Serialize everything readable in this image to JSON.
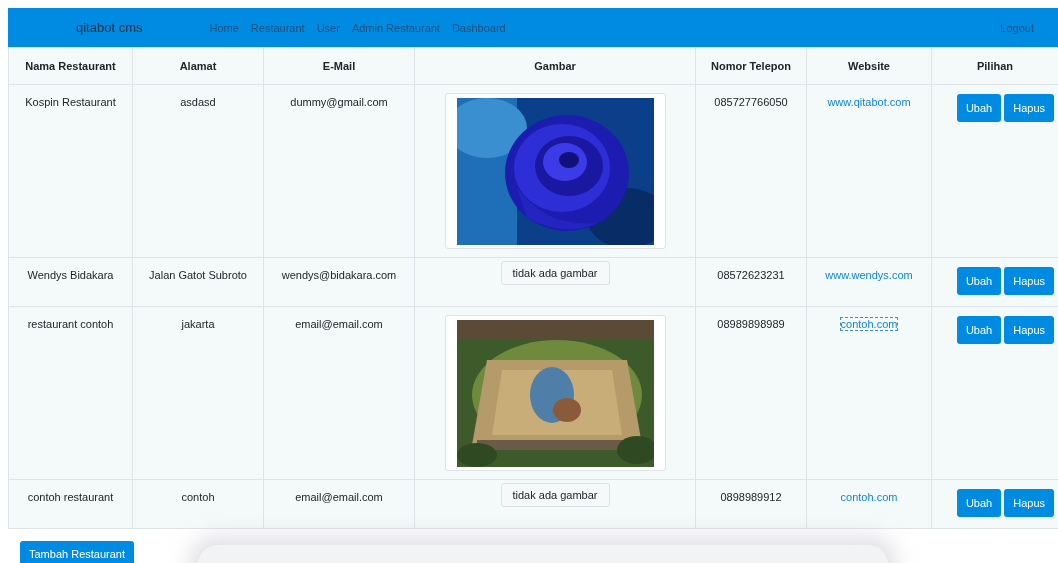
{
  "navbar": {
    "brand": "qitabot cms",
    "links": [
      "Home",
      "Restaurant",
      "User",
      "Admin Restaurant",
      "Dashboard"
    ],
    "logout": "Logout"
  },
  "table": {
    "columns": [
      "Nama Restaurant",
      "Alamat",
      "E-Mail",
      "Gambar",
      "Nomor Telepon",
      "Website",
      "Pilihan"
    ],
    "rows": [
      {
        "name": "Kospin Restaurant",
        "address": "asdasd",
        "email": "dummy@gmail.com",
        "phone": "085727766050",
        "website": "www.qitabot.com",
        "website_focused": false,
        "actions": [
          "Ubah",
          "Hapus"
        ]
      },
      {
        "name": "Wendys Bidakara",
        "address": "Jalan Gatot Subroto",
        "email": "wendys@bidakara.com",
        "image": {
          "kind": "none",
          "label": "tidak ada gambar"
        },
        "phone": "08572623231",
        "website": "www.wendys.com",
        "website_focused": false,
        "actions": [
          "Ubah",
          "Hapus"
        ]
      },
      {
        "name": "restaurant contoh",
        "address": "jakarta",
        "email": "email@email.com",
        "phone": "08989898989",
        "website": "contoh.com",
        "website_focused": true,
        "actions": [
          "Ubah",
          "Hapus"
        ]
      },
      {
        "name": "contoh restaurant",
        "address": "contoh",
        "email": "email@email.com",
        "image": {
          "kind": "none",
          "label": "tidak ada gambar"
        },
        "phone": "0898989912",
        "website": "contoh.com",
        "website_focused": false,
        "actions": [
          "Ubah",
          "Hapus"
        ]
      }
    ]
  },
  "add_button": "Tambah Restaurant"
}
